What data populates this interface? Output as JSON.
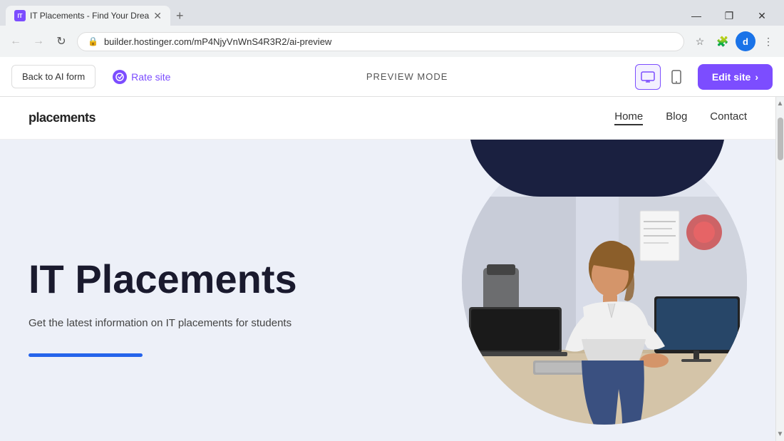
{
  "browser": {
    "tab_title": "IT Placements - Find Your Drea",
    "tab_favicon_text": "IT",
    "url": "builder.hostinger.com/mP4NjyVnWnS4R3R2/ai-preview",
    "win_min": "—",
    "win_max": "❐",
    "win_close": "✕"
  },
  "toolbar": {
    "back_label": "Back to AI form",
    "rate_label": "Rate site",
    "preview_mode_label": "PREVIEW MODE",
    "edit_site_label": "Edit site",
    "edit_site_arrow": "›",
    "device_desktop_icon": "🖥",
    "device_mobile_icon": "📱"
  },
  "site": {
    "logo": "placements",
    "nav": {
      "home": "Home",
      "blog": "Blog",
      "contact": "Contact"
    },
    "hero": {
      "title": "IT Placements",
      "subtitle": "Get the latest information on IT placements for students"
    }
  }
}
